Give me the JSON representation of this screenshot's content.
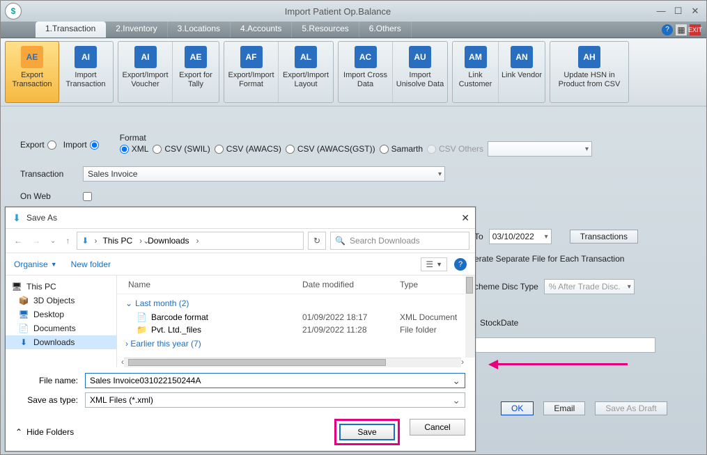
{
  "window": {
    "title": "Import Patient Op.Balance",
    "logo_text": "$"
  },
  "tabs": [
    "1.Transaction",
    "2.Inventory",
    "3.Locations",
    "4.Accounts",
    "5.Resources",
    "6.Others"
  ],
  "ribbon": [
    {
      "items": [
        {
          "ico": "AE",
          "label": "Export Transaction",
          "sel": true,
          "wide": false
        },
        {
          "ico": "AI",
          "label": "Import Transaction",
          "wide": false
        }
      ]
    },
    {
      "items": [
        {
          "ico": "AI",
          "label": "Export/Import Voucher",
          "wide": false
        },
        {
          "ico": "AE",
          "label": "Export for Tally",
          "wide": false,
          "small": true
        }
      ]
    },
    {
      "items": [
        {
          "ico": "AF",
          "label": "Export/Import Format",
          "wide": false
        },
        {
          "ico": "AL",
          "label": "Export/Import Layout",
          "wide": false
        }
      ]
    },
    {
      "items": [
        {
          "ico": "AC",
          "label": "Import Cross Data",
          "wide": false
        },
        {
          "ico": "AU",
          "label": "Import Unisolve Data",
          "wide": false
        }
      ]
    },
    {
      "items": [
        {
          "ico": "AM",
          "label": "Link Customer",
          "wide": false,
          "small": true
        },
        {
          "ico": "AN",
          "label": "Link Vendor",
          "wide": false,
          "small": true
        }
      ]
    },
    {
      "items": [
        {
          "ico": "AH",
          "label": "Update HSN in Product from CSV",
          "wide": true
        }
      ]
    }
  ],
  "form": {
    "export_label": "Export",
    "import_label": "Import",
    "format_label": "Format",
    "formats": [
      {
        "label": "XML",
        "checked": true
      },
      {
        "label": "CSV (SWIL)",
        "checked": false
      },
      {
        "label": "CSV (AWACS)",
        "checked": false
      },
      {
        "label": "CSV (AWACS(GST))",
        "checked": false
      },
      {
        "label": "Samarth",
        "checked": false
      },
      {
        "label": "CSV Others",
        "checked": false,
        "disabled": true
      }
    ],
    "transaction_label": "Transaction",
    "transaction_value": "Sales Invoice",
    "onweb_label": "On Web",
    "to_label": "To",
    "to_date": "03/10/2022",
    "transactions_btn": "Transactions",
    "separate_file": "erate Separate File for Each Transaction",
    "scheme_label": "cheme Disc Type",
    "scheme_value": "% After Trade Disc.",
    "stockdate_label": "StockDate",
    "ok": "OK",
    "email": "Email",
    "draft": "Save As Draft"
  },
  "dialog": {
    "title": "Save As",
    "breadcrumb": [
      "This PC",
      "Downloads"
    ],
    "search_placeholder": "Search Downloads",
    "organise": "Organise",
    "newfolder": "New folder",
    "tree": [
      {
        "icon": "🖥",
        "label": "This PC",
        "root": true
      },
      {
        "icon": "📦",
        "label": "3D Objects"
      },
      {
        "icon": "🖥",
        "label": "Desktop"
      },
      {
        "icon": "📄",
        "label": "Documents"
      },
      {
        "icon": "⬇",
        "label": "Downloads",
        "sel": true
      }
    ],
    "cols": {
      "c1": "Name",
      "c2": "Date modified",
      "c3": "Type"
    },
    "group1": {
      "caret": "⌄",
      "label": "Last month (2)"
    },
    "rows": [
      {
        "icon": "📄",
        "name": "Barcode format",
        "date": "01/09/2022 18:17",
        "type": "XML Document"
      },
      {
        "icon": "📁",
        "name": "Pvt. Ltd._files",
        "date": "21/09/2022 11:28",
        "type": "File folder"
      }
    ],
    "group2": "Earlier this year (7)",
    "filename_label": "File name:",
    "filename_value": "Sales Invoice031022150244A",
    "savetype_label": "Save as type:",
    "savetype_value": "XML Files (*.xml)",
    "hide": "Hide Folders",
    "save": "Save",
    "cancel": "Cancel"
  }
}
